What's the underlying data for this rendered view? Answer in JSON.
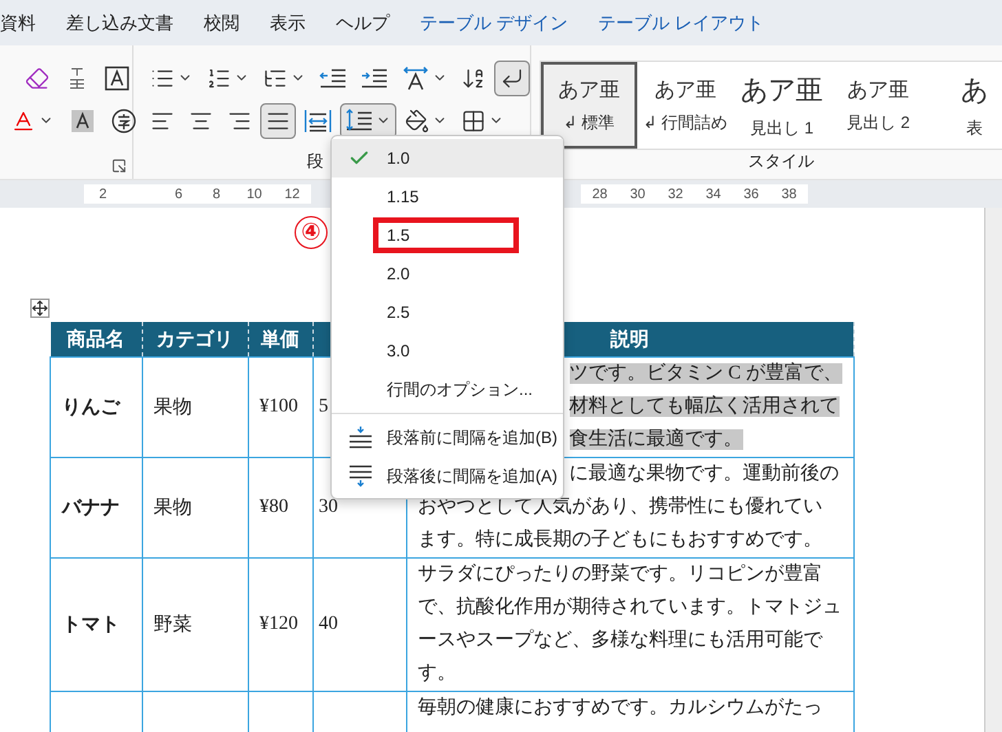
{
  "menu_tabs": [
    {
      "label": "資料",
      "contextual": false
    },
    {
      "label": "差し込み文書",
      "contextual": false
    },
    {
      "label": "校閲",
      "contextual": false
    },
    {
      "label": "表示",
      "contextual": false
    },
    {
      "label": "ヘルプ",
      "contextual": false
    },
    {
      "label": "テーブル デザイン",
      "contextual": true
    },
    {
      "label": "テーブル レイアウト",
      "contextual": true
    }
  ],
  "ribbon": {
    "font_group": {
      "rows": [
        [
          {
            "kind": "clear_format",
            "pressed": false,
            "dropdown": false
          },
          {
            "kind": "phonetic",
            "pressed": false,
            "dropdown": false
          },
          {
            "kind": "char_border",
            "pressed": false,
            "dropdown": false
          }
        ],
        [
          {
            "kind": "font_color",
            "pressed": false,
            "dropdown": true
          },
          {
            "kind": "char_shading",
            "pressed": false,
            "dropdown": false
          },
          {
            "kind": "enclose",
            "pressed": false,
            "dropdown": false
          }
        ]
      ]
    },
    "paragraph_group": {
      "label": "段",
      "rows": [
        [
          {
            "kind": "bullets",
            "pressed": false,
            "dropdown": true
          },
          {
            "kind": "numbering",
            "pressed": false,
            "dropdown": true
          },
          {
            "kind": "multilevel",
            "pressed": false,
            "dropdown": true
          },
          {
            "kind": "outdent",
            "pressed": false,
            "dropdown": false
          },
          {
            "kind": "indent",
            "pressed": false,
            "dropdown": false
          },
          {
            "kind": "text_direction",
            "pressed": false,
            "dropdown": true
          },
          {
            "kind": "sort",
            "pressed": false,
            "dropdown": false
          },
          {
            "kind": "show_marks",
            "pressed": true,
            "dropdown": false
          }
        ],
        [
          {
            "kind": "align_left",
            "pressed": false,
            "dropdown": false
          },
          {
            "kind": "align_center",
            "pressed": false,
            "dropdown": false
          },
          {
            "kind": "align_right",
            "pressed": false,
            "dropdown": false
          },
          {
            "kind": "justify",
            "pressed": true,
            "dropdown": false
          },
          {
            "kind": "distribute",
            "pressed": false,
            "dropdown": false
          },
          {
            "kind": "line_spacing",
            "pressed": true,
            "dropdown": true
          },
          {
            "kind": "shading",
            "pressed": false,
            "dropdown": true
          },
          {
            "kind": "borders",
            "pressed": false,
            "dropdown": true
          }
        ]
      ]
    },
    "styles_group": {
      "label": "スタイル",
      "items": [
        {
          "preview": "あア亜",
          "prefix": "↲",
          "label": "標準",
          "selected": true
        },
        {
          "preview": "あア亜",
          "prefix": "↲",
          "label": "行間詰め",
          "selected": false
        },
        {
          "preview": "あア亜",
          "label": "見出し 1",
          "selected": false
        },
        {
          "preview": "あア亜",
          "label": "見出し 2",
          "selected": false
        },
        {
          "preview": "あ",
          "label": "表",
          "selected": false
        }
      ]
    }
  },
  "ruler": {
    "left_numbers": [
      "2",
      "6",
      "8",
      "10",
      "12"
    ],
    "right_numbers": [
      "28",
      "30",
      "32",
      "34",
      "36",
      "38"
    ]
  },
  "table": {
    "columns": [
      "商品名",
      "カテゴリ",
      "単価",
      "説明"
    ],
    "rows": [
      {
        "name": "りんご",
        "category": "果物",
        "price": "¥100",
        "column_4": "5",
        "selected": true,
        "description": [
          {
            "text": "ツです。ビタミン C が豊富で、",
            "partly_hidden": true
          },
          {
            "text": "材料としても幅広く活用されて",
            "partly_hidden": true
          },
          {
            "text": "食生活に最適です。",
            "partly_hidden": true
          }
        ]
      },
      {
        "name": "バナナ",
        "category": "果物",
        "price": "¥80",
        "column_4": "30",
        "selected": false,
        "description": [
          {
            "text": "に最適な果物です。運動前後の",
            "partly_hidden": true
          },
          {
            "text": "おやつとして人気があり、携帯性にも優れてい"
          },
          {
            "text": "ます。特に成長期の子どもにもおすすめです。"
          }
        ]
      },
      {
        "name": "トマト",
        "category": "野菜",
        "price": "¥120",
        "column_4": "40",
        "selected": false,
        "description": [
          {
            "text": "サラダにぴったりの野菜です。リコピンが豊富"
          },
          {
            "text": "で、抗酸化作用が期待されています。トマトジュ"
          },
          {
            "text": "ースやスープなど、多様な料理にも活用可能で"
          },
          {
            "text": "す。"
          }
        ]
      },
      {
        "selected": false,
        "description": [
          {
            "text": "毎朝の健康におすすめです。カルシウムがたっ"
          }
        ]
      }
    ]
  },
  "line_spacing_menu": {
    "items": [
      {
        "kind": "option",
        "label": "1.0",
        "checked": true,
        "highlighted": false
      },
      {
        "kind": "option",
        "label": "1.15",
        "checked": false,
        "highlighted": false
      },
      {
        "kind": "option",
        "label": "1.5",
        "checked": false,
        "highlighted": true
      },
      {
        "kind": "option",
        "label": "2.0",
        "checked": false,
        "highlighted": false
      },
      {
        "kind": "option",
        "label": "2.5",
        "checked": false,
        "highlighted": false
      },
      {
        "kind": "option",
        "label": "3.0",
        "checked": false,
        "highlighted": false
      },
      {
        "kind": "link",
        "label": "行間のオプション..."
      },
      {
        "kind": "separator"
      },
      {
        "kind": "space_before",
        "label": "段落前に間隔を追加(B)"
      },
      {
        "kind": "space_after",
        "label": "段落後に間隔を追加(A)"
      }
    ]
  },
  "annotation": {
    "step": "④"
  }
}
